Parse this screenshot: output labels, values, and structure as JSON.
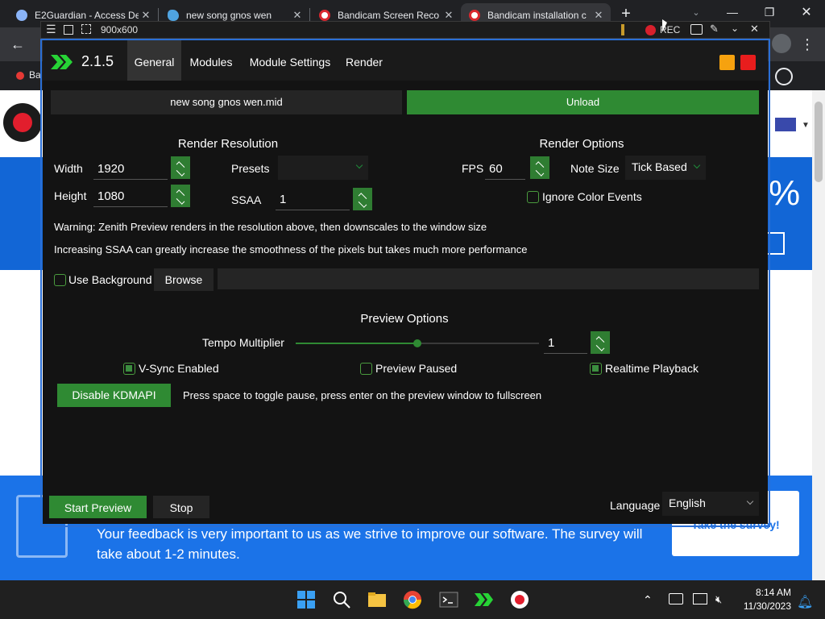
{
  "browser": {
    "tabs": [
      {
        "title": "E2Guardian - Access De",
        "icon": "shield-globe-icon"
      },
      {
        "title": "new song gnos wen",
        "icon": "bird-icon"
      },
      {
        "title": "Bandicam Screen Reco",
        "icon": "record-icon"
      },
      {
        "title": "Bandicam installation c",
        "icon": "record-icon"
      }
    ],
    "new_tab_label": "+",
    "bookmark_label": "Ba"
  },
  "capture_bar": {
    "size_label": "900x600",
    "rec_label": "REC"
  },
  "app": {
    "version": "2.1.5",
    "tabs": [
      "General",
      "Modules",
      "Module Settings",
      "Render"
    ],
    "active_tab": "General",
    "file_name": "new song gnos wen.mid",
    "unload_label": "Unload",
    "render_resolution": {
      "title": "Render Resolution",
      "width_label": "Width",
      "width_value": "1920",
      "height_label": "Height",
      "height_value": "1080",
      "presets_label": "Presets",
      "presets_value": "",
      "ssaa_label": "SSAA",
      "ssaa_value": "1"
    },
    "render_options": {
      "title": "Render Options",
      "fps_label": "FPS",
      "fps_value": "60",
      "note_size_label": "Note Size",
      "note_size_value": "Tick Based",
      "ignore_color_label": "Ignore Color Events",
      "ignore_color_checked": false
    },
    "warnings": [
      "Warning: Zenith Preview renders in the resolution above, then downscales to the window size",
      "Increasing SSAA can greatly increase the smoothness of the pixels but takes much more performance"
    ],
    "background": {
      "use_label": "Use Background",
      "checked": false,
      "browse_label": "Browse",
      "path": ""
    },
    "preview_options": {
      "title": "Preview Options",
      "tempo_label": "Tempo Multiplier",
      "tempo_value": "1",
      "tempo_slider_fraction": 0.5,
      "vsync_label": "V-Sync Enabled",
      "vsync_checked": true,
      "paused_label": "Preview Paused",
      "paused_checked": false,
      "realtime_label": "Realtime Playback",
      "realtime_checked": true
    },
    "kdmapi_label": "Disable KDMAPI",
    "hint": "Press space to toggle pause, press enter on the preview window to fullscreen",
    "start_label": "Start Preview",
    "stop_label": "Stop",
    "language_label": "Language",
    "language_value": "English"
  },
  "webpage": {
    "feedback_text": "Your feedback is very important to us as we strive to improve our software. The survey will take about 1-2 minutes.",
    "survey_label": "Take the survey!",
    "hero_fragment": "%"
  },
  "taskbar": {
    "time": "8:14 AM",
    "date": "11/30/2023"
  },
  "colors": {
    "accent_green": "#2f8a33",
    "app_bg": "#131313",
    "web_blue": "#1b73e8"
  }
}
